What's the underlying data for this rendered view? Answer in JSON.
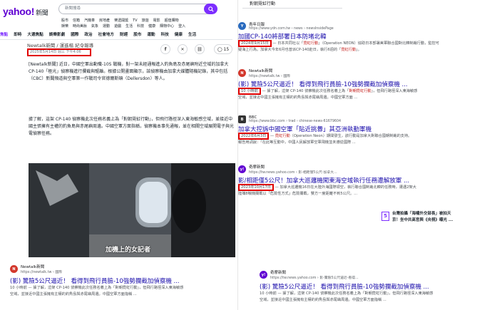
{
  "yahoo": {
    "logo": "yahoo!",
    "logo_sub": "新聞",
    "search_placeholder": "新聞搜尋",
    "quick_links_row1": [
      "股市",
      "信箱",
      "汽機車",
      "房地產",
      "樂透開獎",
      "TV",
      "旅遊",
      "電影",
      "超值購物"
    ],
    "quick_links_row2": [
      "娛樂",
      "時尚美妝",
      "氣象",
      "運動",
      "遊戲",
      "生活",
      "科技",
      "健康",
      "購物中心",
      "登入"
    ],
    "nav": [
      "焦點",
      "即時",
      "大選焦點",
      "娛樂影劇",
      "國際",
      "政治",
      "社會地方",
      "財經",
      "股市",
      "運動",
      "科技",
      "健康",
      "生活"
    ],
    "article_header": "Newtalk新聞 / 運進楷 紀令報導",
    "article_date": "2025年5月14日 週三 下午4:06",
    "comment_count": "15",
    "para1": "[Newtalk新聞] 近日，中國空軍出動殲-10S 戰機，對一架未經通報進入釣魚島及赤尾嶼附近空域的加拿大 CP-140「極光」偵察機進行攔截與驅離。根據公開畫面顯示，該偵察機由加拿大媒體隨機記錄，其中包括（CBC）新聞頻道與空軍第一作戰司令官德爾斯頓（Dellersdon）等人。",
    "para2": "據了解，這架 CP-140 偵察機此次任務名義上為「對朝霓虹行動」，但飛行路徑深入東海敏感空域，並接近中國主張擁有主權的釣魚島與赤尾嶼周邊。中國空軍方面指稱，偵察機本事先通報，並在相關空域展開電子與光電偵察任務。",
    "video_caption": "加機上的女記者",
    "bottom_site": "Newtalk新聞",
    "bottom_url": "https://newtalk.tw › 國際",
    "bottom_title": "(影) 驚險5公尺逼近！ 看得到飛行員臉-10強勢攔截加偵察機 ...",
    "bottom_snip1": "10 小時前 — 據了解，這架 CP-140 偵察機此次任務名義上為「對朝霓虹行動」，但飛行路徑深入東海敏感",
    "bottom_snip2": "空域，並接近中國主張擁有主權的釣魚島與赤尾嶼周邊。中國空軍方面指稱 ..."
  },
  "google": {
    "query": "對朝霓虹行動",
    "results": [
      {
        "site": "青年日報",
        "url": "https://www.ydn.com.tw › news › newsInsidePage",
        "title": "加國CP-140將部署日本防堵北韓",
        "date": "2024年9月15日",
        "snip1_a": " — 日本共同社以「",
        "snip1_hl": "霓虹行動",
        "snip1_b": "」（Operation NEON）協助日本部署美軍聯合國對北韓制裁行動，監控可",
        "snip2_a": "疑海上行為。加拿大今年6月也曾派CP-140赴日，執行6週的「",
        "snip2_hl": "霓虹行動",
        "snip2_b": "」。",
        "favicon": "Y",
        "favicon_color": "#2a6bbf"
      },
      {
        "site": "Newtalk新聞",
        "url": "https://newtalk.tw › 國際",
        "title": "(影) 驚險5公尺逼近！ 看得到飛行員臉-10強勢攔截加偵察機 ...",
        "date": "10 小時前",
        "snip1_a": " — 據了解，這架 CP-140 偵察機此次任務名義上為「",
        "snip1_hl": "對朝霓虹行動",
        "snip1_b": "」，但飛行路徑深入東海敏感",
        "snip2_a": "空域，並接近中國主張擁有主權的釣魚島與赤尾嶼周邊。中國空軍方面 ...",
        "snip2_hl": "",
        "snip2_b": "",
        "favicon": "N",
        "favicon_color": "#d3382d"
      },
      {
        "site": "BBC",
        "url": "https://www.bbc.com › trad › chinese-news-61679604",
        "title": "加拿大控訴中國空軍「貼近挑釁」其亞洲執勤軍機",
        "date": "2022年6月3日",
        "snip1_a": " — ",
        "snip1_hl": "霓虹行動",
        "snip1_b": "（Operation Neon）期間發生，該行動是加拿大對聯合國朝制裁的支持。",
        "snip2_a": "報告用詞說：「在此等互動中，中國人民解放軍空軍飛機並未遵從國際 ...",
        "snip2_hl": "",
        "snip2_b": "",
        "favicon": "B",
        "favicon_color": "#333333"
      },
      {
        "site": "奇摩新聞",
        "url": "https://tw.news.yahoo.com › 影-相距僅5公尺-加拿大...",
        "title": "影/相距僅5公尺！加拿大巡邏機闖東海空域執行任務遭解放軍 ...",
        "date": "2023年10月17日",
        "snip1_a": " — 加拿大巡邏機16日在大陸外海國際領空，執行聯合國制裁北韓的任務時，遭遇2架大",
        "snip1_hl": "",
        "snip1_b": "",
        "snip2_a": "陸殲8戰機攔截以「危險性方式」危險攔截，雙方一度距離不到5公尺。...",
        "snip2_hl": "",
        "snip2_b": "",
        "favicon": "y!",
        "favicon_color": "#6001d2"
      }
    ],
    "side_teaser_num": "5",
    "side_teaser_line1": "台灣拍攝「海嘯外交部長」被拍天",
    "side_teaser_line2": "京！坐中共高官與《央視》曝光 ...",
    "bottom_site": "奇摩新聞",
    "bottom_url": "https://tw.news.yahoo.com › 影-驚險5公尺逼近-看得...",
    "bottom_title": "(影) 驚險5公尺逼近！ 看得到飛行員臉-10強勢攔截加偵察機 ...",
    "bottom_snip1": "10 小時前 — 據了解，這架 CP-140 偵察機此次任務名義上為「對朝霓虹行動」，但飛行路徑深入東海敏感",
    "bottom_snip2": "空域，並接近中國主張擁有主權的釣魚島與赤尾嶼周邊。中國空軍方面指稱 ..."
  }
}
